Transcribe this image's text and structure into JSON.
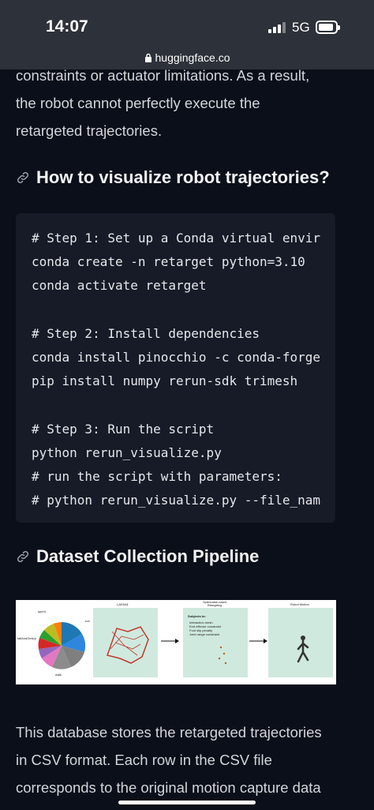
{
  "status": {
    "time": "14:07",
    "network": "5G"
  },
  "browser": {
    "url": "huggingface.co"
  },
  "intro_paragraph": [
    "constraints or actuator limitations. As a result,",
    "the robot cannot perfectly execute the",
    "retargeted trajectories."
  ],
  "section1": {
    "heading": "How to visualize robot trajectories?"
  },
  "code_lines": [
    "# Step 1: Set up a Conda virtual envir",
    "conda create -n retarget python=3.10",
    "conda activate retarget",
    "",
    "# Step 2: Install dependencies",
    "conda install pinocchio -c conda-forge",
    "pip install numpy rerun-sdk trimesh",
    "",
    "# Step 3: Run the script",
    "python rerun_visualize.py",
    "# run the script with parameters:",
    "# python rerun_visualize.py --file_nam"
  ],
  "section2": {
    "heading": "Dataset Collection Pipeline"
  },
  "figure": {
    "panel1_title": "LAFAN1",
    "panel2_title": "Optimization-based Retargeting",
    "panel3_title": "Robot Motion",
    "subject_to": "Subjects to:",
    "constraints": [
      "Interaction mesh",
      "End effector constraint",
      "Foot slip penalty",
      "Joint range constraint"
    ],
    "pie_labels": [
      "walk",
      "run",
      "dance",
      "jumps",
      "fallAndGetUp",
      "fight",
      "sprint",
      "aiming",
      "obstacles",
      "ground",
      "pushAndStumble",
      "multipleActions"
    ]
  },
  "outro_paragraph": [
    "This database stores the retargeted trajectories",
    "in CSV format. Each row in the CSV file",
    "corresponds to the original motion capture data"
  ]
}
